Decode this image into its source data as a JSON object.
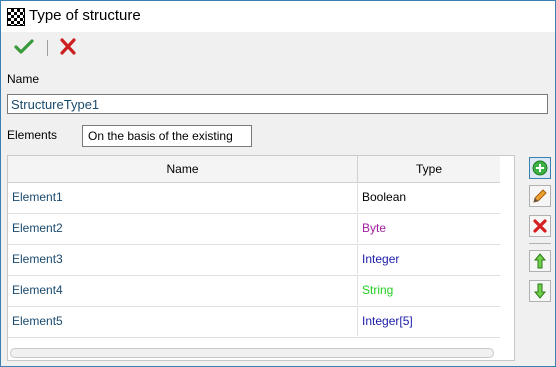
{
  "window": {
    "title": "Type of structure",
    "app_icon": "grid-app-icon"
  },
  "toolbar": {
    "ok_icon": "checkmark-icon",
    "cancel_icon": "close-icon",
    "ok_color": "#3a9a3a",
    "cancel_color": "#cc1f1f"
  },
  "form": {
    "name_label": "Name",
    "name_value": "StructureType1",
    "elements_label": "Elements",
    "elements_mode": "On the basis of the existing"
  },
  "table": {
    "headers": [
      "Name",
      "Type"
    ],
    "rows": [
      {
        "name": "Element1",
        "type": "Boolean",
        "type_color": "#000000"
      },
      {
        "name": "Element2",
        "type": "Byte",
        "type_color": "#a020a0"
      },
      {
        "name": "Element3",
        "type": "Integer",
        "type_color": "#1a1aa8"
      },
      {
        "name": "Element4",
        "type": "String",
        "type_color": "#22d022"
      },
      {
        "name": "Element5",
        "type": "Integer[5]",
        "type_color": "#1a1aa8"
      }
    ]
  },
  "side_toolbar": {
    "add_icon": "add-circle-icon",
    "edit_icon": "pencil-icon",
    "delete_icon": "delete-x-icon",
    "up_icon": "arrow-up-icon",
    "down_icon": "arrow-down-icon"
  }
}
